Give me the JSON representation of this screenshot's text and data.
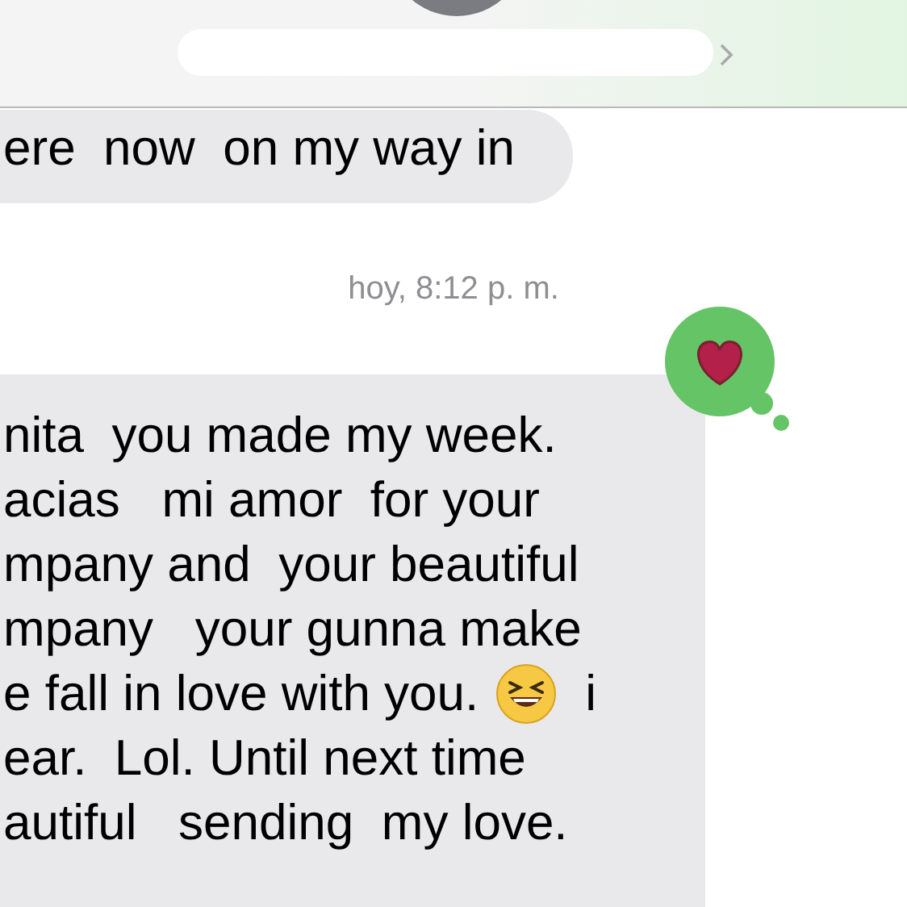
{
  "header": {
    "contact_name_redacted": true
  },
  "messages": [
    {
      "kind": "received",
      "lines": [
        "ere  now  on my way in"
      ]
    },
    {
      "kind": "timestamp",
      "text": "hoy, 8:12 p. m."
    },
    {
      "kind": "received",
      "heart_reaction": true,
      "lines": [
        {
          "text": "nita  you made my week."
        },
        {
          "text": "acias   mi amor  for your"
        },
        {
          "text": "mpany and  your beautiful"
        },
        {
          "text": "mpany   your gunna make"
        },
        {
          "text": "e fall in love with you.",
          "after_emoji": "i"
        },
        {
          "text": "ear.  Lol. Until next time"
        },
        {
          "text": "autiful   sending  my love."
        }
      ]
    }
  ]
}
